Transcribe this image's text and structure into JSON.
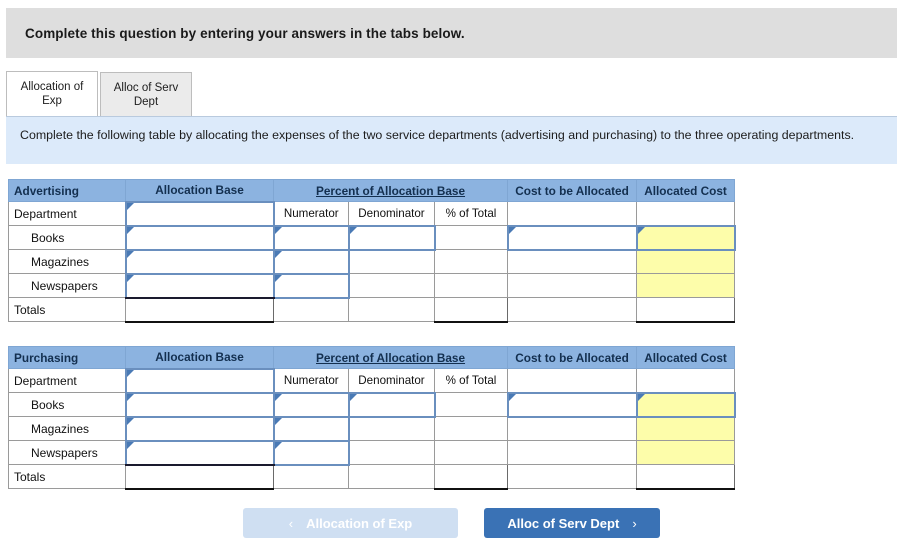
{
  "top_banner": {
    "text": "Complete this question by entering your answers in the tabs below."
  },
  "tabs": [
    {
      "label": "Allocation of Exp",
      "name": "tab-allocation-of-exp",
      "active": true
    },
    {
      "label": "Alloc of Serv Dept",
      "name": "tab-alloc-of-serv-dept",
      "active": false
    }
  ],
  "info_banner": {
    "text": "Complete the following table by allocating the expenses of the two service departments (advertising and purchasing) to the three operating departments."
  },
  "table_headers": {
    "allocation_base": "Allocation Base",
    "percent_of_allocation_base": "Percent of Allocation Base",
    "cost_to_be_allocated": "Cost to be Allocated",
    "allocated_cost": "Allocated Cost"
  },
  "subheaders": {
    "department": "Department",
    "numerator": "Numerator",
    "denominator": "Denominator",
    "percent_of_total": "% of Total"
  },
  "row_labels": {
    "books": "Books",
    "magazines": "Magazines",
    "newspapers": "Newspapers",
    "totals": "Totals"
  },
  "tables": [
    {
      "name": "table-advertising",
      "title": "Advertising",
      "rows": [
        {
          "label": "Books",
          "allocation_base": "",
          "numerator": "",
          "denominator": "",
          "percent_of_total": "",
          "cost_to_be_allocated": "",
          "allocated_cost": ""
        },
        {
          "label": "Magazines",
          "allocation_base": "",
          "numerator": "",
          "denominator": "",
          "percent_of_total": "",
          "cost_to_be_allocated": "",
          "allocated_cost": ""
        },
        {
          "label": "Newspapers",
          "allocation_base": "",
          "numerator": "",
          "denominator": "",
          "percent_of_total": "",
          "cost_to_be_allocated": "",
          "allocated_cost": ""
        },
        {
          "label": "Totals",
          "allocation_base": "",
          "numerator": "",
          "denominator": "",
          "percent_of_total": "",
          "cost_to_be_allocated": "",
          "allocated_cost": ""
        }
      ]
    },
    {
      "name": "table-purchasing",
      "title": "Purchasing",
      "rows": [
        {
          "label": "Books",
          "allocation_base": "",
          "numerator": "",
          "denominator": "",
          "percent_of_total": "",
          "cost_to_be_allocated": "",
          "allocated_cost": ""
        },
        {
          "label": "Magazines",
          "allocation_base": "",
          "numerator": "",
          "denominator": "",
          "percent_of_total": "",
          "cost_to_be_allocated": "",
          "allocated_cost": ""
        },
        {
          "label": "Newspapers",
          "allocation_base": "",
          "numerator": "",
          "denominator": "",
          "percent_of_total": "",
          "cost_to_be_allocated": "",
          "allocated_cost": ""
        },
        {
          "label": "Totals",
          "allocation_base": "",
          "numerator": "",
          "denominator": "",
          "percent_of_total": "",
          "cost_to_be_allocated": "",
          "allocated_cost": ""
        }
      ]
    }
  ],
  "footer": {
    "prev_label": "Allocation of Exp",
    "prev_chevron": "‹",
    "next_label": "Alloc of Serv Dept",
    "next_chevron": "›"
  },
  "colors": {
    "top_banner_bg": "#dedede",
    "info_banner_bg": "#dceafa",
    "table_header_bg": "#8cb3e0",
    "table_header_text": "#132f4f",
    "input_border": "#6a8fbe",
    "input_flag": "#4a7ab5",
    "highlight_yellow": "#fdfdaa",
    "next_button_bg": "#3a72b5",
    "prev_button_bg": "#cfdff2"
  }
}
